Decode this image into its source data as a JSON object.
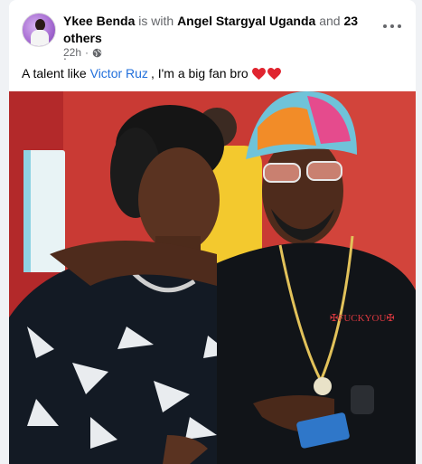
{
  "post": {
    "author": "Ykee Benda",
    "with_text": "is with",
    "tagged": "Angel Stargyal Uganda",
    "and_text": "and",
    "others": "23 others",
    "dot": ".",
    "time": "22h",
    "dot_sep": "·",
    "caption_prefix": "A talent like",
    "caption_link": "Victor Ruz",
    "caption_suffix": ", I'm a big fan bro"
  },
  "icons": {
    "privacy": "globe-icon",
    "menu": "more-options-icon",
    "emoji": "red-heart-icon"
  },
  "colors": {
    "link": "#216fdb",
    "heart": "#e0242f"
  }
}
